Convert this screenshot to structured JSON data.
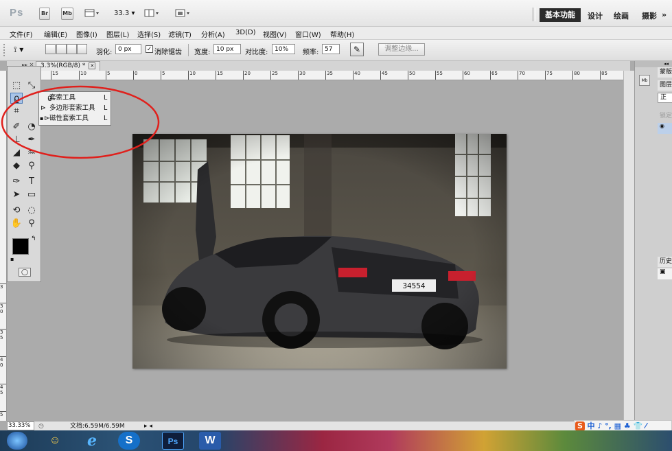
{
  "titlebar": {
    "app_logo": "Ps",
    "bridge_label": "Br",
    "minibridge_label": "Mb",
    "zoom_value": "33.3",
    "workspaces": [
      "基本功能",
      "设计",
      "绘画",
      "摄影",
      "»"
    ]
  },
  "menubar": {
    "items": [
      "文件(F)",
      "编辑(E)",
      "图像(I)",
      "图层(L)",
      "选择(S)",
      "滤镜(T)",
      "分析(A)",
      "3D(D)",
      "视图(V)",
      "窗口(W)",
      "帮助(H)"
    ]
  },
  "options": {
    "feather_label": "羽化:",
    "feather_value": "0 px",
    "antialias_label": "消除锯齿",
    "width_label": "宽度:",
    "width_value": "10 px",
    "contrast_label": "对比度:",
    "contrast_value": "10%",
    "frequency_label": "频率:",
    "frequency_value": "57",
    "refine_edge_button": "调整边缘..."
  },
  "document": {
    "tab_title": "3.3%(RGB/8) *",
    "ruler_h": [
      "15",
      "10",
      "5",
      "0",
      "5",
      "10",
      "15",
      "20",
      "25",
      "30",
      "35",
      "40",
      "45",
      "50",
      "55",
      "60",
      "65",
      "70",
      "75",
      "80",
      "85"
    ],
    "ruler_v": [
      "3",
      "3 0",
      "3 5",
      "4 0",
      "4 5",
      "5"
    ]
  },
  "flyout": {
    "items": [
      {
        "label": "套索工具",
        "key": "L",
        "selected": false
      },
      {
        "label": "多边形套索工具",
        "key": "L",
        "selected": false
      },
      {
        "label": "磁性套索工具",
        "key": "L",
        "selected": true
      }
    ],
    "bullet": "▪"
  },
  "photo": {
    "plate": "34554"
  },
  "statusbar": {
    "zoom": "33.33%",
    "doc_size": "文档:6.59M/6.59M"
  },
  "rightpanel": {
    "tab1": "蒙版",
    "tab2": "图层",
    "blend_mode": "正常",
    "lock_label": "锁定",
    "history_label": "历史",
    "mb_label": "Mb"
  },
  "ime": {
    "text": "中 ♪ °, ▦ ♣ 👕 ⁄"
  },
  "taskbar": {
    "ps_label": "Ps",
    "w_label": "W"
  },
  "colors": {
    "ui_gray": "#d9d9d9",
    "canvas_bg": "#ababab",
    "annotation_red": "#e0201c",
    "workspace_active_bg": "#2b2b2b"
  }
}
